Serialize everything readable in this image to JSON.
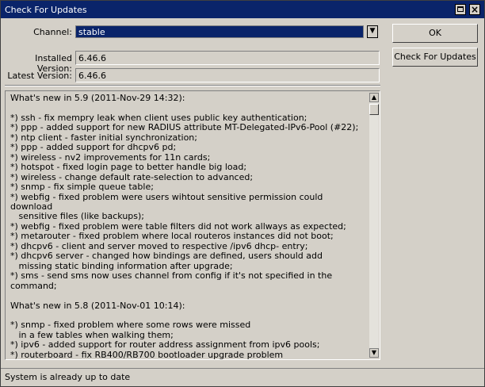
{
  "window": {
    "title": "Check For Updates",
    "close_glyph": "×"
  },
  "form": {
    "channel_label": "Channel:",
    "channel_value": "stable",
    "dropdown_glyph": "▼",
    "installed_label": "Installed Version:",
    "installed_value": "6.46.6",
    "latest_label": "Latest Version:",
    "latest_value": "6.46.6"
  },
  "buttons": {
    "ok": "OK",
    "check": "Check For Updates"
  },
  "changelog": {
    "text": "What's new in 5.9 (2011-Nov-29 14:32):\n\n*) ssh - fix mempry leak when client uses public key authentication;\n*) ppp - added support for new RADIUS attribute MT-Delegated-IPv6-Pool (#22);\n*) ntp client - faster initial synchronization;\n*) ppp - added support for dhcpv6 pd;\n*) wireless - nv2 improvements for 11n cards;\n*) hotspot - fixed login page to better handle big load;\n*) wireless - change default rate-selection to advanced;\n*) snmp - fix simple queue table;\n*) webfig - fixed problem were users wihtout sensitive permission could download\n   sensitive files (like backups);\n*) webfig - fixed problem were table filters did not work allways as expected;\n*) metarouter - fixed problem where local routeros instances did not boot;\n*) dhcpv6 - client and server moved to respective /ipv6 dhcp- entry;\n*) dhcpv6 server - changed how bindings are defined, users should add\n   missing static binding information after upgrade;\n*) sms - send sms now uses channel from config if it's not specified in the command;\n\nWhat's new in 5.8 (2011-Nov-01 10:14):\n\n*) snmp - fixed problem where some rows were missed\n   in a few tables when walking them;\n*) ipv6 - added support for router address assignment from ipv6 pools;\n*) routerboard - fix RB400/RB700 bootloader upgrade problem",
    "scroll_up_glyph": "▲",
    "scroll_down_glyph": "▼"
  },
  "status": {
    "text": "System is already up to date"
  }
}
